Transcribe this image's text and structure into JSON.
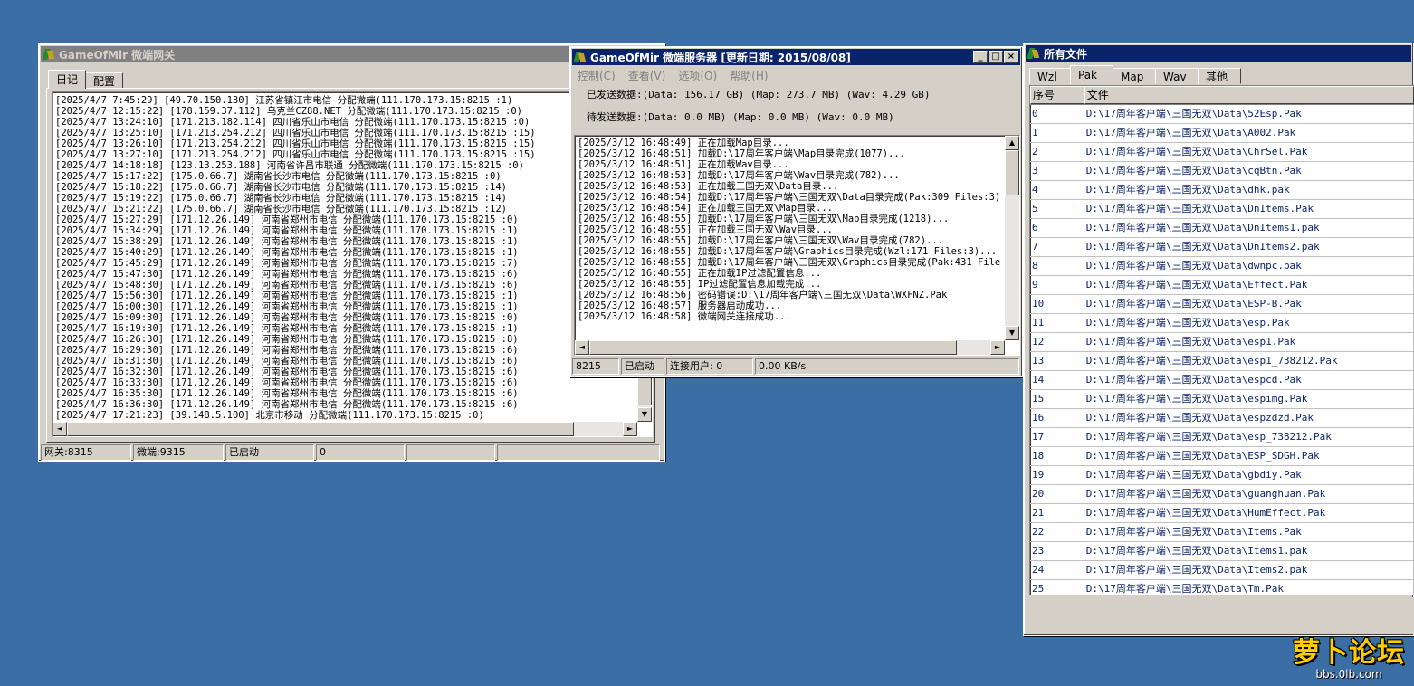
{
  "gateway": {
    "title": "GameOfMir 微端网关",
    "tabs": [
      "日记",
      "配置"
    ],
    "logs": [
      "[2025/4/7 7:45:29] [49.70.150.130] 江苏省镇江市电信 分配微端(111.170.173.15:8215 :1)",
      "[2025/4/7 12:15:22] [178.159.37.112] 乌克兰CZ88.NET 分配微端(111.170.173.15:8215 :0)",
      "[2025/4/7 13:24:10] [171.213.182.114] 四川省乐山市电信 分配微端(111.170.173.15:8215 :0)",
      "[2025/4/7 13:25:10] [171.213.254.212] 四川省乐山市电信 分配微端(111.170.173.15:8215 :15)",
      "[2025/4/7 13:26:10] [171.213.254.212] 四川省乐山市电信 分配微端(111.170.173.15:8215 :15)",
      "[2025/4/7 13:27:10] [171.213.254.212] 四川省乐山市电信 分配微端(111.170.173.15:8215 :15)",
      "[2025/4/7 14:18:18] [123.13.253.188] 河南省许昌市联通 分配微端(111.170.173.15:8215 :0)",
      "[2025/4/7 15:17:22] [175.0.66.7] 湖南省长沙市电信 分配微端(111.170.173.15:8215 :0)",
      "[2025/4/7 15:18:22] [175.0.66.7] 湖南省长沙市电信 分配微端(111.170.173.15:8215 :14)",
      "[2025/4/7 15:19:22] [175.0.66.7] 湖南省长沙市电信 分配微端(111.170.173.15:8215 :14)",
      "[2025/4/7 15:21:22] [175.0.66.7] 湖南省长沙市电信 分配微端(111.170.173.15:8215 :12)",
      "[2025/4/7 15:27:29] [171.12.26.149] 河南省郑州市电信 分配微端(111.170.173.15:8215 :0)",
      "[2025/4/7 15:34:29] [171.12.26.149] 河南省郑州市电信 分配微端(111.170.173.15:8215 :1)",
      "[2025/4/7 15:38:29] [171.12.26.149] 河南省郑州市电信 分配微端(111.170.173.15:8215 :1)",
      "[2025/4/7 15:40:29] [171.12.26.149] 河南省郑州市电信 分配微端(111.170.173.15:8215 :1)",
      "[2025/4/7 15:45:29] [171.12.26.149] 河南省郑州市电信 分配微端(111.170.173.15:8215 :7)",
      "[2025/4/7 15:47:30] [171.12.26.149] 河南省郑州市电信 分配微端(111.170.173.15:8215 :6)",
      "[2025/4/7 15:48:30] [171.12.26.149] 河南省郑州市电信 分配微端(111.170.173.15:8215 :6)",
      "[2025/4/7 15:56:30] [171.12.26.149] 河南省郑州市电信 分配微端(111.170.173.15:8215 :1)",
      "[2025/4/7 16:00:30] [171.12.26.149] 河南省郑州市电信 分配微端(111.170.173.15:8215 :1)",
      "[2025/4/7 16:09:30] [171.12.26.149] 河南省郑州市电信 分配微端(111.170.173.15:8215 :0)",
      "[2025/4/7 16:19:30] [171.12.26.149] 河南省郑州市电信 分配微端(111.170.173.15:8215 :1)",
      "[2025/4/7 16:26:30] [171.12.26.149] 河南省郑州市电信 分配微端(111.170.173.15:8215 :8)",
      "[2025/4/7 16:29:30] [171.12.26.149] 河南省郑州市电信 分配微端(111.170.173.15:8215 :6)",
      "[2025/4/7 16:31:30] [171.12.26.149] 河南省郑州市电信 分配微端(111.170.173.15:8215 :6)",
      "[2025/4/7 16:32:30] [171.12.26.149] 河南省郑州市电信 分配微端(111.170.173.15:8215 :6)",
      "[2025/4/7 16:33:30] [171.12.26.149] 河南省郑州市电信 分配微端(111.170.173.15:8215 :6)",
      "[2025/4/7 16:35:30] [171.12.26.149] 河南省郑州市电信 分配微端(111.170.173.15:8215 :6)",
      "[2025/4/7 16:36:30] [171.12.26.149] 河南省郑州市电信 分配微端(111.170.173.15:8215 :6)",
      "[2025/4/7 17:21:23] [39.148.5.100] 北京市移动 分配微端(111.170.173.15:8215 :0)"
    ],
    "status": [
      "网关:8315",
      "微端:9315",
      "已启动",
      "0",
      "",
      ""
    ]
  },
  "server": {
    "title": "GameOfMir 微端服务器 [更新日期: 2015/08/08]",
    "menu": [
      "控制(C)",
      "查看(V)",
      "选项(O)",
      "帮助(H)"
    ],
    "sent": "已发送数据:(Data: 156.17 GB) (Map: 273.7 MB) (Wav: 4.29 GB)",
    "pending": "待发送数据:(Data: 0.0 MB) (Map: 0.0 MB) (Wav: 0.0 MB)",
    "logs": [
      "[2025/3/12 16:48:49] 正在加载Map目录...",
      "[2025/3/12 16:48:51] 加载D:\\17周年客户端\\Map目录完成(1077)...",
      "[2025/3/12 16:48:51] 正在加载Wav目录...",
      "[2025/3/12 16:48:53] 加载D:\\17周年客户端\\Wav目录完成(782)...",
      "[2025/3/12 16:48:53] 正在加载三国无双\\Data目录...",
      "[2025/3/12 16:48:54] 加载D:\\17周年客户端\\三国无双\\Data目录完成(Pak:309 Files:3)",
      "[2025/3/12 16:48:54] 正在加载三国无双\\Map目录...",
      "[2025/3/12 16:48:55] 加载D:\\17周年客户端\\三国无双\\Map目录完成(1218)...",
      "[2025/3/12 16:48:55] 正在加载三国无双\\Wav目录...",
      "[2025/3/12 16:48:55] 加载D:\\17周年客户端\\三国无双\\Wav目录完成(782)...",
      "[2025/3/12 16:48:55] 加载D:\\17周年客户端\\Graphics目录完成(Wzl:171 Files:3)...",
      "[2025/3/12 16:48:55] 加载D:\\17周年客户端\\三国无双\\Graphics目录完成(Pak:431 File",
      "[2025/3/12 16:48:55] 正在加载IP过滤配置信息...",
      "[2025/3/12 16:48:55] IP过滤配置信息加载完成...",
      "[2025/3/12 16:48:56] 密码错误:D:\\17周年客户端\\三国无双\\Data\\WXFNZ.Pak",
      "[2025/3/12 16:48:57] 服务器启动成功...",
      "[2025/3/12 16:48:58] 微端网关连接成功..."
    ],
    "status": [
      "8215",
      "已启动",
      "连接用户: 0",
      "0.00 KB/s"
    ]
  },
  "files": {
    "title": "所有文件",
    "tabs": [
      "Wzl",
      "Pak",
      "Map",
      "Wav",
      "其他"
    ],
    "headers": [
      "序号",
      "文件"
    ],
    "rows": [
      [
        "0",
        "D:\\17周年客户端\\三国无双\\Data\\52Esp.Pak"
      ],
      [
        "1",
        "D:\\17周年客户端\\三国无双\\Data\\A002.Pak"
      ],
      [
        "2",
        "D:\\17周年客户端\\三国无双\\Data\\ChrSel.Pak"
      ],
      [
        "3",
        "D:\\17周年客户端\\三国无双\\Data\\cqBtn.Pak"
      ],
      [
        "4",
        "D:\\17周年客户端\\三国无双\\Data\\dhk.pak"
      ],
      [
        "5",
        "D:\\17周年客户端\\三国无双\\Data\\DnItems.Pak"
      ],
      [
        "6",
        "D:\\17周年客户端\\三国无双\\Data\\DnItems1.pak"
      ],
      [
        "7",
        "D:\\17周年客户端\\三国无双\\Data\\DnItems2.pak"
      ],
      [
        "8",
        "D:\\17周年客户端\\三国无双\\Data\\dwnpc.pak"
      ],
      [
        "9",
        "D:\\17周年客户端\\三国无双\\Data\\Effect.Pak"
      ],
      [
        "10",
        "D:\\17周年客户端\\三国无双\\Data\\ESP-B.Pak"
      ],
      [
        "11",
        "D:\\17周年客户端\\三国无双\\Data\\esp.Pak"
      ],
      [
        "12",
        "D:\\17周年客户端\\三国无双\\Data\\esp1.Pak"
      ],
      [
        "13",
        "D:\\17周年客户端\\三国无双\\Data\\esp1_738212.Pak"
      ],
      [
        "14",
        "D:\\17周年客户端\\三国无双\\Data\\espcd.Pak"
      ],
      [
        "15",
        "D:\\17周年客户端\\三国无双\\Data\\espimg.Pak"
      ],
      [
        "16",
        "D:\\17周年客户端\\三国无双\\Data\\espzdzd.Pak"
      ],
      [
        "17",
        "D:\\17周年客户端\\三国无双\\Data\\esp_738212.Pak"
      ],
      [
        "18",
        "D:\\17周年客户端\\三国无双\\Data\\ESP_SDGH.Pak"
      ],
      [
        "19",
        "D:\\17周年客户端\\三国无双\\Data\\gbdiy.Pak"
      ],
      [
        "20",
        "D:\\17周年客户端\\三国无双\\Data\\guanghuan.Pak"
      ],
      [
        "21",
        "D:\\17周年客户端\\三国无双\\Data\\HumEffect.Pak"
      ],
      [
        "22",
        "D:\\17周年客户端\\三国无双\\Data\\Items.Pak"
      ],
      [
        "23",
        "D:\\17周年客户端\\三国无双\\Data\\Items1.pak"
      ],
      [
        "24",
        "D:\\17周年客户端\\三国无双\\Data\\Items2.pak"
      ],
      [
        "25",
        "D:\\17周年客户端\\三国无双\\Data\\Tm.Pak"
      ]
    ]
  },
  "watermark": {
    "main": "萝卜论坛",
    "sub": "bbs.0lb.com"
  },
  "colors": {
    "desktop": "#3a6ea5",
    "active_title": "#0a246a",
    "inactive_title": "#808080",
    "window": "#d4d0c8",
    "link_text": "#0a246a"
  }
}
